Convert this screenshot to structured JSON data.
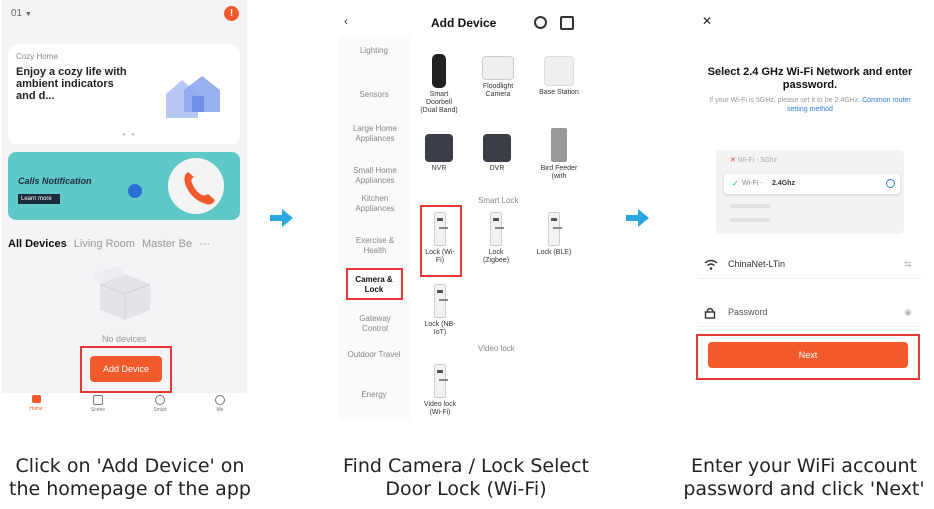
{
  "screen1": {
    "home_selector": "01",
    "banner_label": "Cozy Home",
    "banner_text": "Enjoy a cozy life with ambient indicators and d...",
    "promo_text": "Calls Notification",
    "promo_button": "Learn more",
    "tabs": [
      "All Devices",
      "Living Room",
      "Master Be"
    ],
    "more": "···",
    "empty_text": "No devices",
    "add_button": "Add Device",
    "nav": [
      "Home",
      "Scene",
      "Smart",
      "Me"
    ]
  },
  "screen2": {
    "title": "Add Device",
    "categories": [
      "Lighting",
      "Sensors",
      "Large Home Appliances",
      "Small Home Appliances",
      "Kitchen Appliances",
      "Exercise & Health",
      "Camera & Lock",
      "Gateway Control",
      "Outdoor Travel",
      "Energy"
    ],
    "row1": [
      "Smart Doorbell (Dual Band)",
      "Floodlight Camera",
      "Base Station"
    ],
    "row2": [
      "NVR",
      "DVR",
      "Bird Feeder (with"
    ],
    "smart_lock_heading": "Smart Lock",
    "locks": [
      "Lock (Wi-Fi)",
      "Lock (Zigbee)",
      "Lock (BLE)"
    ],
    "lock_nbiot": "Lock (NB-IoT)",
    "video_lock_heading": "Video lock",
    "video_lock": "Video lock (Wi-Fi)"
  },
  "screen3": {
    "close": "✕",
    "title": "Select 2.4 GHz Wi-Fi Network and enter password.",
    "hint": "If your Wi-Fi is 5GHz, please set it to be 2.4GHz.",
    "hint_link": "Common router setting method",
    "wifi_5g": "Wi-Fi - 5Ghz",
    "wifi_24_prefix": "Wi-Fi - ",
    "wifi_24": "2.4Ghz",
    "ssid_value": "ChinaNet-LTin",
    "password_placeholder": "Password",
    "next_button": "Next"
  },
  "captions": [
    "Click on 'Add Device' on\nthe homepage of the app",
    "Find Camera / Lock Select\nDoor Lock (Wi-Fi)",
    "Enter your WiFi account\npassword and click 'Next'"
  ],
  "colors": {
    "accent": "#f25a2b",
    "red_highlight": "#e53935",
    "arrow": "#2aa7e0",
    "link": "#2f7de1",
    "teal": "#5fc9c9"
  },
  "icons": [
    "dropdown-icon",
    "notification-icon",
    "house-icon",
    "phone-icon",
    "box-icon",
    "home-icon",
    "scene-icon",
    "smart-icon",
    "me-icon",
    "back-icon",
    "scan-icon",
    "qr-icon",
    "close-icon",
    "wifi-icon",
    "lock-icon",
    "eye-icon",
    "arrow-right-icon"
  ]
}
